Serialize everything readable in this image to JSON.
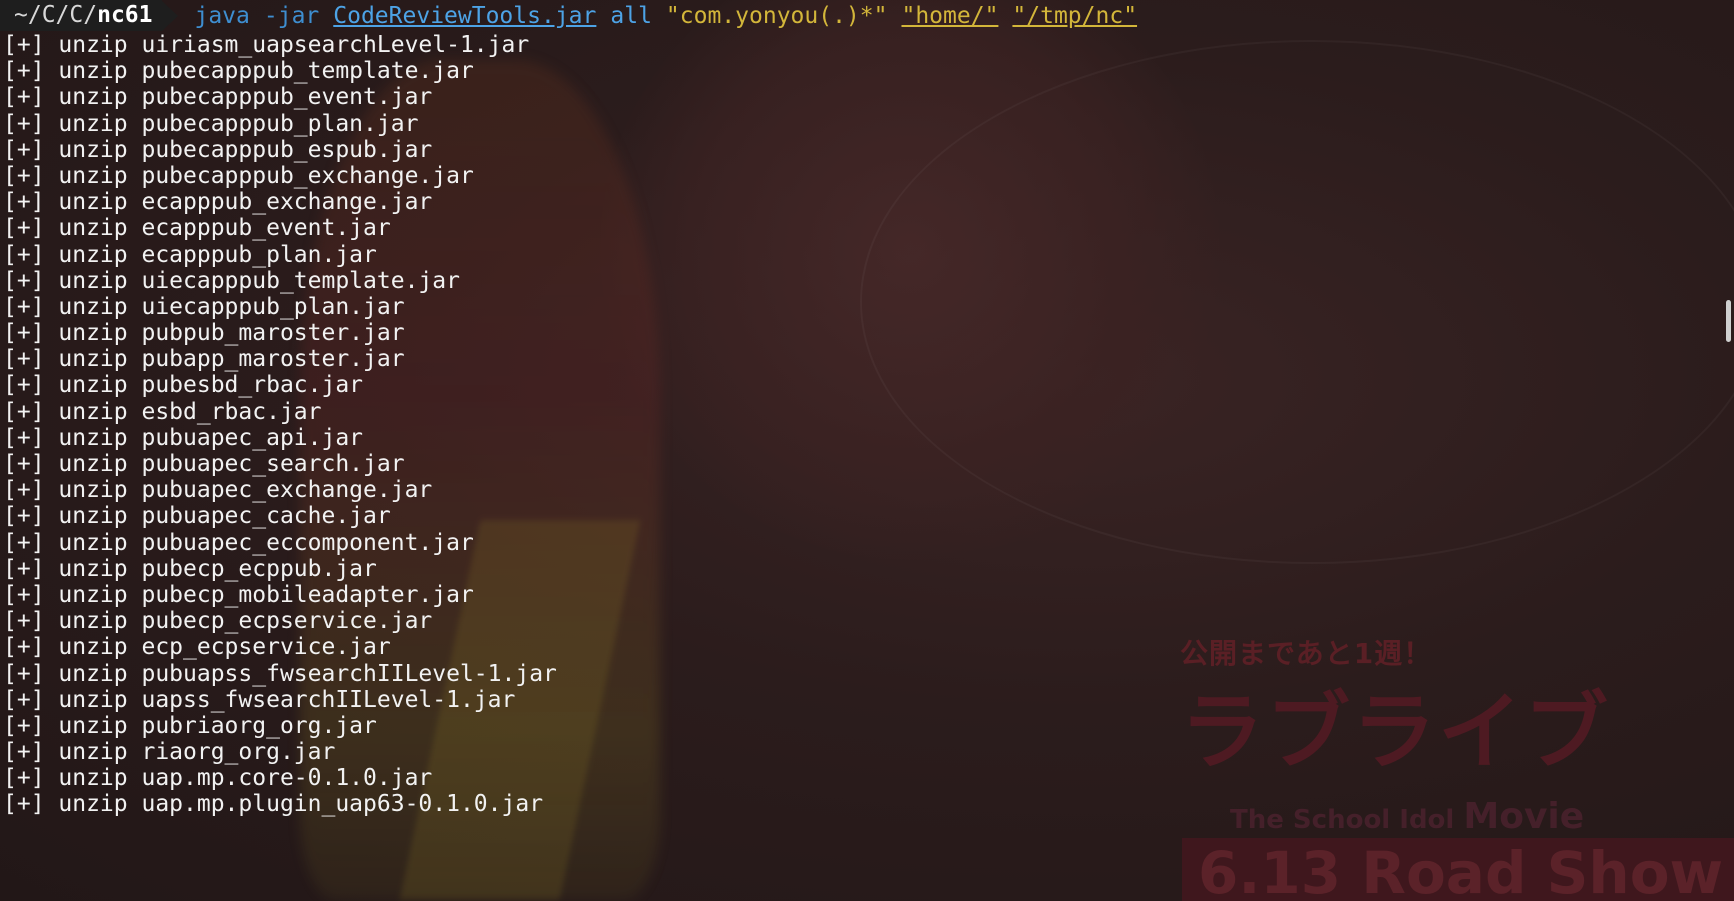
{
  "prompt": {
    "path_prefix": "~/C/C/",
    "path_dir": "nc61",
    "tokens": {
      "cmd": "java",
      "flag": "-jar",
      "file": "CodeReviewTools.jar",
      "mode": "all",
      "pattern": "\"com.yonyou(.)*\"",
      "src": "\"home/\"",
      "dst": "\"/tmp/nc\""
    }
  },
  "output": [
    "[+] unzip uiriasm_uapsearchLevel-1.jar",
    "[+] unzip pubecapppub_template.jar",
    "[+] unzip pubecapppub_event.jar",
    "[+] unzip pubecapppub_plan.jar",
    "[+] unzip pubecapppub_espub.jar",
    "[+] unzip pubecapppub_exchange.jar",
    "[+] unzip ecapppub_exchange.jar",
    "[+] unzip ecapppub_event.jar",
    "[+] unzip ecapppub_plan.jar",
    "[+] unzip uiecapppub_template.jar",
    "[+] unzip uiecapppub_plan.jar",
    "[+] unzip pubpub_maroster.jar",
    "[+] unzip pubapp_maroster.jar",
    "[+] unzip pubesbd_rbac.jar",
    "[+] unzip esbd_rbac.jar",
    "[+] unzip pubuapec_api.jar",
    "[+] unzip pubuapec_search.jar",
    "[+] unzip pubuapec_exchange.jar",
    "[+] unzip pubuapec_cache.jar",
    "[+] unzip pubuapec_eccomponent.jar",
    "[+] unzip pubecp_ecppub.jar",
    "[+] unzip pubecp_mobileadapter.jar",
    "[+] unzip pubecp_ecpservice.jar",
    "[+] unzip ecp_ecpservice.jar",
    "[+] unzip pubuapss_fwsearchIILevel-1.jar",
    "[+] unzip uapss_fwsearchIILevel-1.jar",
    "[+] unzip pubriaorg_org.jar",
    "[+] unzip riaorg_org.jar",
    "[+] unzip uap.mp.core-0.1.0.jar",
    "[+] unzip uap.mp.plugin_uap63-0.1.0.jar"
  ],
  "wallpaper": {
    "caption": "公開まであと1週！",
    "logo": "ラブライブ",
    "subtitle": "The School Idol",
    "subtitle_movie": "Movie",
    "date_line": "6.13 Road Show"
  },
  "colors": {
    "background": "#271b1b",
    "prompt_segment": "#1e1e1e",
    "command": "#3e8ed0",
    "string": "#d3b63a",
    "output_text": "#f2f2f2"
  }
}
